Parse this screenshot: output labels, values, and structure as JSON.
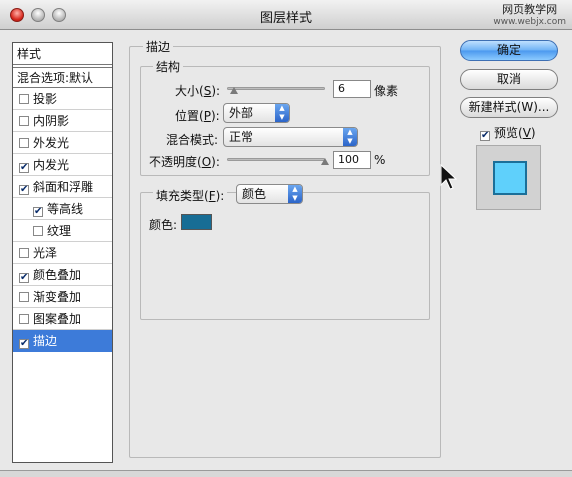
{
  "window": {
    "title": "图层样式",
    "watermark": "网页教学网",
    "watermark_sub": "www.webjx.com"
  },
  "styles_panel": {
    "header": "样式",
    "blend_options": "混合选项:默认",
    "items": [
      {
        "label": "投影",
        "checked": false,
        "sub": false
      },
      {
        "label": "内阴影",
        "checked": false,
        "sub": false
      },
      {
        "label": "外发光",
        "checked": false,
        "sub": false
      },
      {
        "label": "内发光",
        "checked": true,
        "sub": false
      },
      {
        "label": "斜面和浮雕",
        "checked": true,
        "sub": false
      },
      {
        "label": "等高线",
        "checked": true,
        "sub": true
      },
      {
        "label": "纹理",
        "checked": false,
        "sub": true
      },
      {
        "label": "光泽",
        "checked": false,
        "sub": false
      },
      {
        "label": "颜色叠加",
        "checked": true,
        "sub": false
      },
      {
        "label": "渐变叠加",
        "checked": false,
        "sub": false
      },
      {
        "label": "图案叠加",
        "checked": false,
        "sub": false
      },
      {
        "label": "描边",
        "checked": true,
        "sub": false,
        "selected": true
      }
    ]
  },
  "stroke": {
    "section_title": "描边",
    "structure_title": "结构",
    "size_label_pre": "大小(",
    "size_key": "S",
    "size_label_post": "):",
    "size_value": "6",
    "size_unit": "像素",
    "size_level": 0.03,
    "position_label_pre": "位置(",
    "position_key": "P",
    "position_label_post": "):",
    "position_value": "外部",
    "blend_mode_label_pre": "混合模式",
    "blend_mode_key": "",
    "blend_mode_label_post": ":",
    "blend_mode_value": "正常",
    "opacity_label_pre": "不透明度(",
    "opacity_key": "O",
    "opacity_label_post": "):",
    "opacity_value": "100",
    "opacity_unit": "%",
    "opacity_level": 1.0,
    "fill_type_label_pre": "填充类型(",
    "fill_type_key": "F",
    "fill_type_label_post": "):",
    "fill_type_value": "颜色",
    "color_label": "颜色:",
    "color_hex": "#176d95"
  },
  "buttons": {
    "ok": "确定",
    "cancel": "取消",
    "new_style": "新建样式(W)...",
    "preview_label_pre": "预览(",
    "preview_key": "V",
    "preview_label_post": ")",
    "preview_checked": true
  },
  "colors": {
    "accent": "#3d7bd9",
    "preview_fill": "#5fd0fb",
    "preview_stroke": "#1b6f99"
  }
}
